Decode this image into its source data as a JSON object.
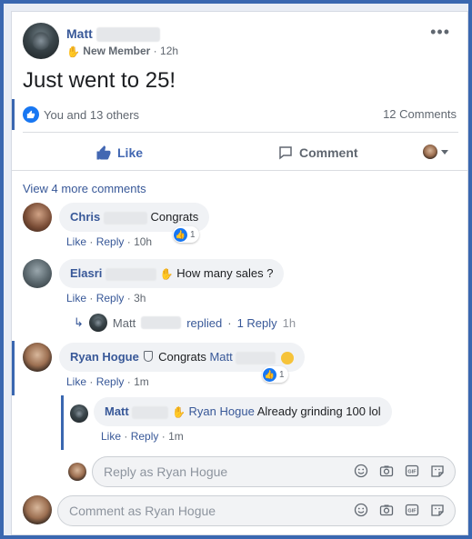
{
  "post": {
    "author": "Matt",
    "badge": "New Member",
    "time": "12h",
    "more": "•••",
    "text": "Just went to 25!",
    "reactions_text": "You and 13 others",
    "comments_count": "12 Comments"
  },
  "actions": {
    "like": "Like",
    "comment": "Comment"
  },
  "view_more": "View 4 more comments",
  "comments": [
    {
      "author": "Chris",
      "text": "Congrats",
      "like": "Like",
      "reply": "Reply",
      "time": "10h",
      "reactions": "1"
    },
    {
      "author": "Elasri",
      "text": "How many sales ?",
      "like": "Like",
      "reply": "Reply",
      "time": "3h"
    },
    {
      "author": "Ryan Hogue",
      "text": "Congrats",
      "mention": "Matt",
      "like": "Like",
      "reply": "Reply",
      "time": "1m",
      "reactions": "1"
    }
  ],
  "elasri_reply_summary": {
    "name": "Matt",
    "replied": "replied",
    "count": "1 Reply",
    "time": "1h"
  },
  "nested_reply": {
    "author": "Matt",
    "mention": "Ryan Hogue",
    "text": "Already grinding 100 lol",
    "like": "Like",
    "reply": "Reply",
    "time": "1m"
  },
  "inputs": {
    "reply_placeholder": "Reply as Ryan Hogue",
    "comment_placeholder": "Comment as Ryan Hogue"
  },
  "colors": {
    "frame": "#3a67b0",
    "link": "#385898",
    "like_blue": "#1877f2"
  }
}
